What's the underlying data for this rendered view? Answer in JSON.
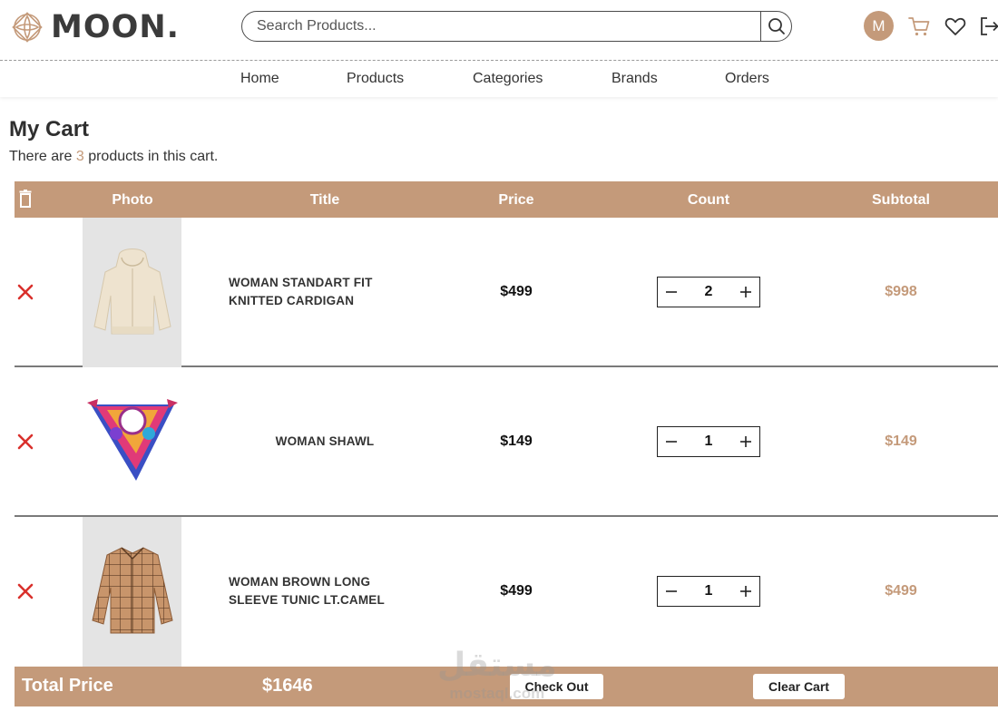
{
  "brand": {
    "name": "MOON.",
    "accent": "#c49a7a"
  },
  "search": {
    "placeholder": "Search Products..."
  },
  "header": {
    "avatar_initial": "M",
    "icons": [
      "search-icon",
      "cart-icon",
      "heart-icon",
      "logout-icon"
    ]
  },
  "nav": {
    "items": [
      "Home",
      "Products",
      "Categories",
      "Brands",
      "Orders"
    ]
  },
  "cart": {
    "title": "My Cart",
    "summary_prefix": "There are",
    "count": "3",
    "summary_suffix": "products in this cart."
  },
  "table": {
    "headers": [
      "Photo",
      "Title",
      "Price",
      "Count",
      "Subtotal"
    ],
    "rows": [
      {
        "title": "WOMAN STANDART FIT KNITTED CARDIGAN",
        "price": "$499",
        "count": "2",
        "subtotal": "$998",
        "photo": "cardigan-image"
      },
      {
        "title": "WOMAN SHAWL",
        "price": "$149",
        "count": "1",
        "subtotal": "$149",
        "photo": "shawl-image"
      },
      {
        "title": "WOMAN BROWN LONG SLEEVE TUNIC LT.CAMEL",
        "price": "$499",
        "count": "1",
        "subtotal": "$499",
        "photo": "tunic-image"
      }
    ]
  },
  "footer": {
    "total_label": "Total Price",
    "total_value": "$1646",
    "checkout_label": "Check Out",
    "clear_label": "Clear Cart"
  },
  "watermark": {
    "arabic": "مستقل",
    "latin": "mostaql.com"
  }
}
